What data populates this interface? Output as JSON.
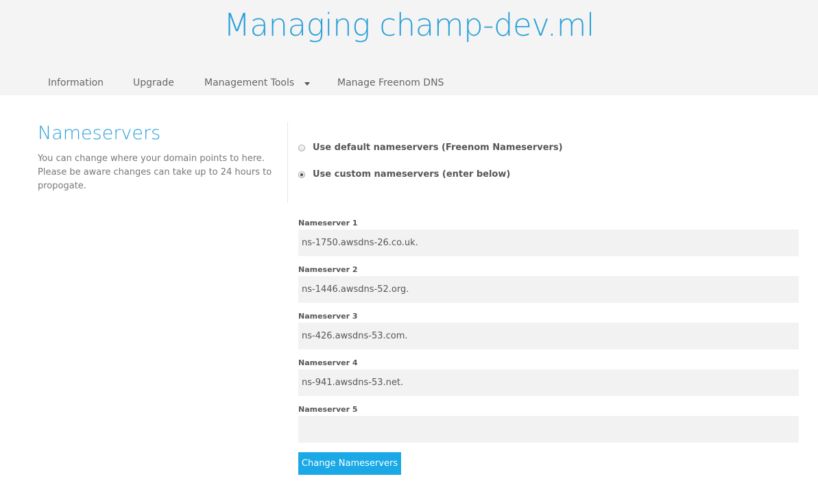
{
  "header": {
    "title": "Managing champ-dev.ml"
  },
  "nav": {
    "items": [
      {
        "label": "Information"
      },
      {
        "label": "Upgrade"
      },
      {
        "label": "Management Tools"
      },
      {
        "label": "Manage Freenom DNS"
      }
    ]
  },
  "section": {
    "title": "Nameservers",
    "description": "You can change where your domain points to here. Please be aware changes can take up to 24 hours to propogate."
  },
  "options": [
    {
      "label": "Use default nameservers (Freenom Nameservers)",
      "checked": false
    },
    {
      "label": "Use custom nameservers (enter below)",
      "checked": true
    }
  ],
  "nameservers": [
    {
      "label": "Nameserver 1",
      "value": "ns-1750.awsdns-26.co.uk."
    },
    {
      "label": "Nameserver 2",
      "value": "ns-1446.awsdns-52.org."
    },
    {
      "label": "Nameserver 3",
      "value": "ns-426.awsdns-53.com."
    },
    {
      "label": "Nameserver 4",
      "value": "ns-941.awsdns-53.net."
    },
    {
      "label": "Nameserver 5",
      "value": ""
    }
  ],
  "submit_label": "Change Nameservers",
  "colors": {
    "accent": "#2aa0d8",
    "button": "#1aa9e6",
    "header_bg": "#f4f4f4",
    "input_bg": "#f2f2f2"
  }
}
